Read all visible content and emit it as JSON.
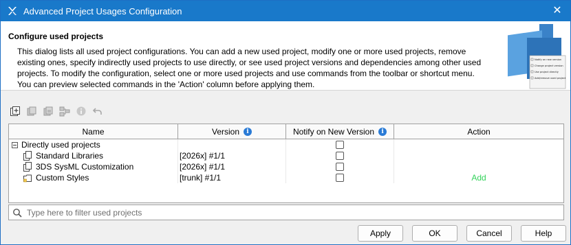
{
  "window": {
    "title": "Advanced Project Usages Configuration"
  },
  "header": {
    "title": "Configure used projects",
    "description": "This dialog lists all used project configurations. You can add a new used project, modify one or more used projects, remove existing ones, specify indirectly used projects to use directly, or see used project versions and dependencies among other used projects. To modify the configuration, select one or more used projects and use commands from the toolbar or shortcut menu. You can preview selected commands in the 'Action' column before applying them.",
    "art_lines": [
      "Notify on new version",
      "Change project version",
      "Use project directly",
      "Add/remove used project"
    ]
  },
  "toolbar": {
    "icons": [
      "add-project-icon",
      "copy-icon",
      "paste-icon",
      "dependencies-icon",
      "info-icon",
      "undo-icon"
    ]
  },
  "table": {
    "columns": {
      "name": "Name",
      "version": "Version",
      "notify": "Notify on New Version",
      "action": "Action"
    },
    "group_label": "Directly used projects",
    "rows": [
      {
        "name": "Standard Libraries",
        "version": "[2026x] #1/1",
        "notify": false,
        "action": ""
      },
      {
        "name": "3DS SysML Customization",
        "version": "[2026x] #1/1",
        "notify": false,
        "action": ""
      },
      {
        "name": "Custom Styles",
        "version": "[trunk] #1/1",
        "notify": false,
        "action": "Add"
      }
    ]
  },
  "filter": {
    "placeholder": "Type here to filter used projects"
  },
  "buttons": {
    "apply": "Apply",
    "ok": "OK",
    "cancel": "Cancel",
    "help": "Help"
  },
  "colors": {
    "titlebar": "#1979ca",
    "action_add": "#32d25a",
    "info": "#2a7bd6"
  }
}
